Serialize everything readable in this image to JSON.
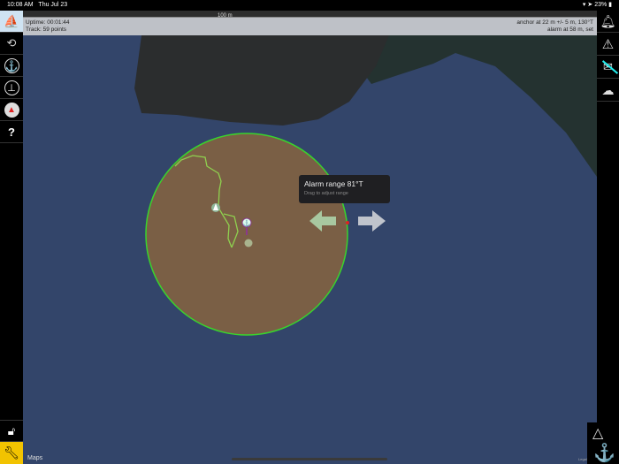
{
  "status": {
    "time": "10:08 AM",
    "date": "Thu Jul 23",
    "battery": "23%"
  },
  "scale": {
    "label": "100 m"
  },
  "info": {
    "uptime": "Uptime: 00:01:44",
    "track": "Track: 59 points",
    "anchor": "anchor at 22 m +/- 5 m, 130°T",
    "alarm": "alarm at 58 m, set"
  },
  "tooltip": {
    "title": "Alarm range 81°T",
    "subtitle": "Drag to adjust range"
  },
  "footer": {
    "maps": "Maps",
    "legal": "Legal"
  },
  "help": "?",
  "colors": {
    "water": "#33456a",
    "land": "#2b2d2e",
    "land_green": "#243230",
    "circle": "#7a5f45",
    "ring": "#39d42c",
    "track": "#8fd14f",
    "toolbar_accent": "#f2c300"
  }
}
